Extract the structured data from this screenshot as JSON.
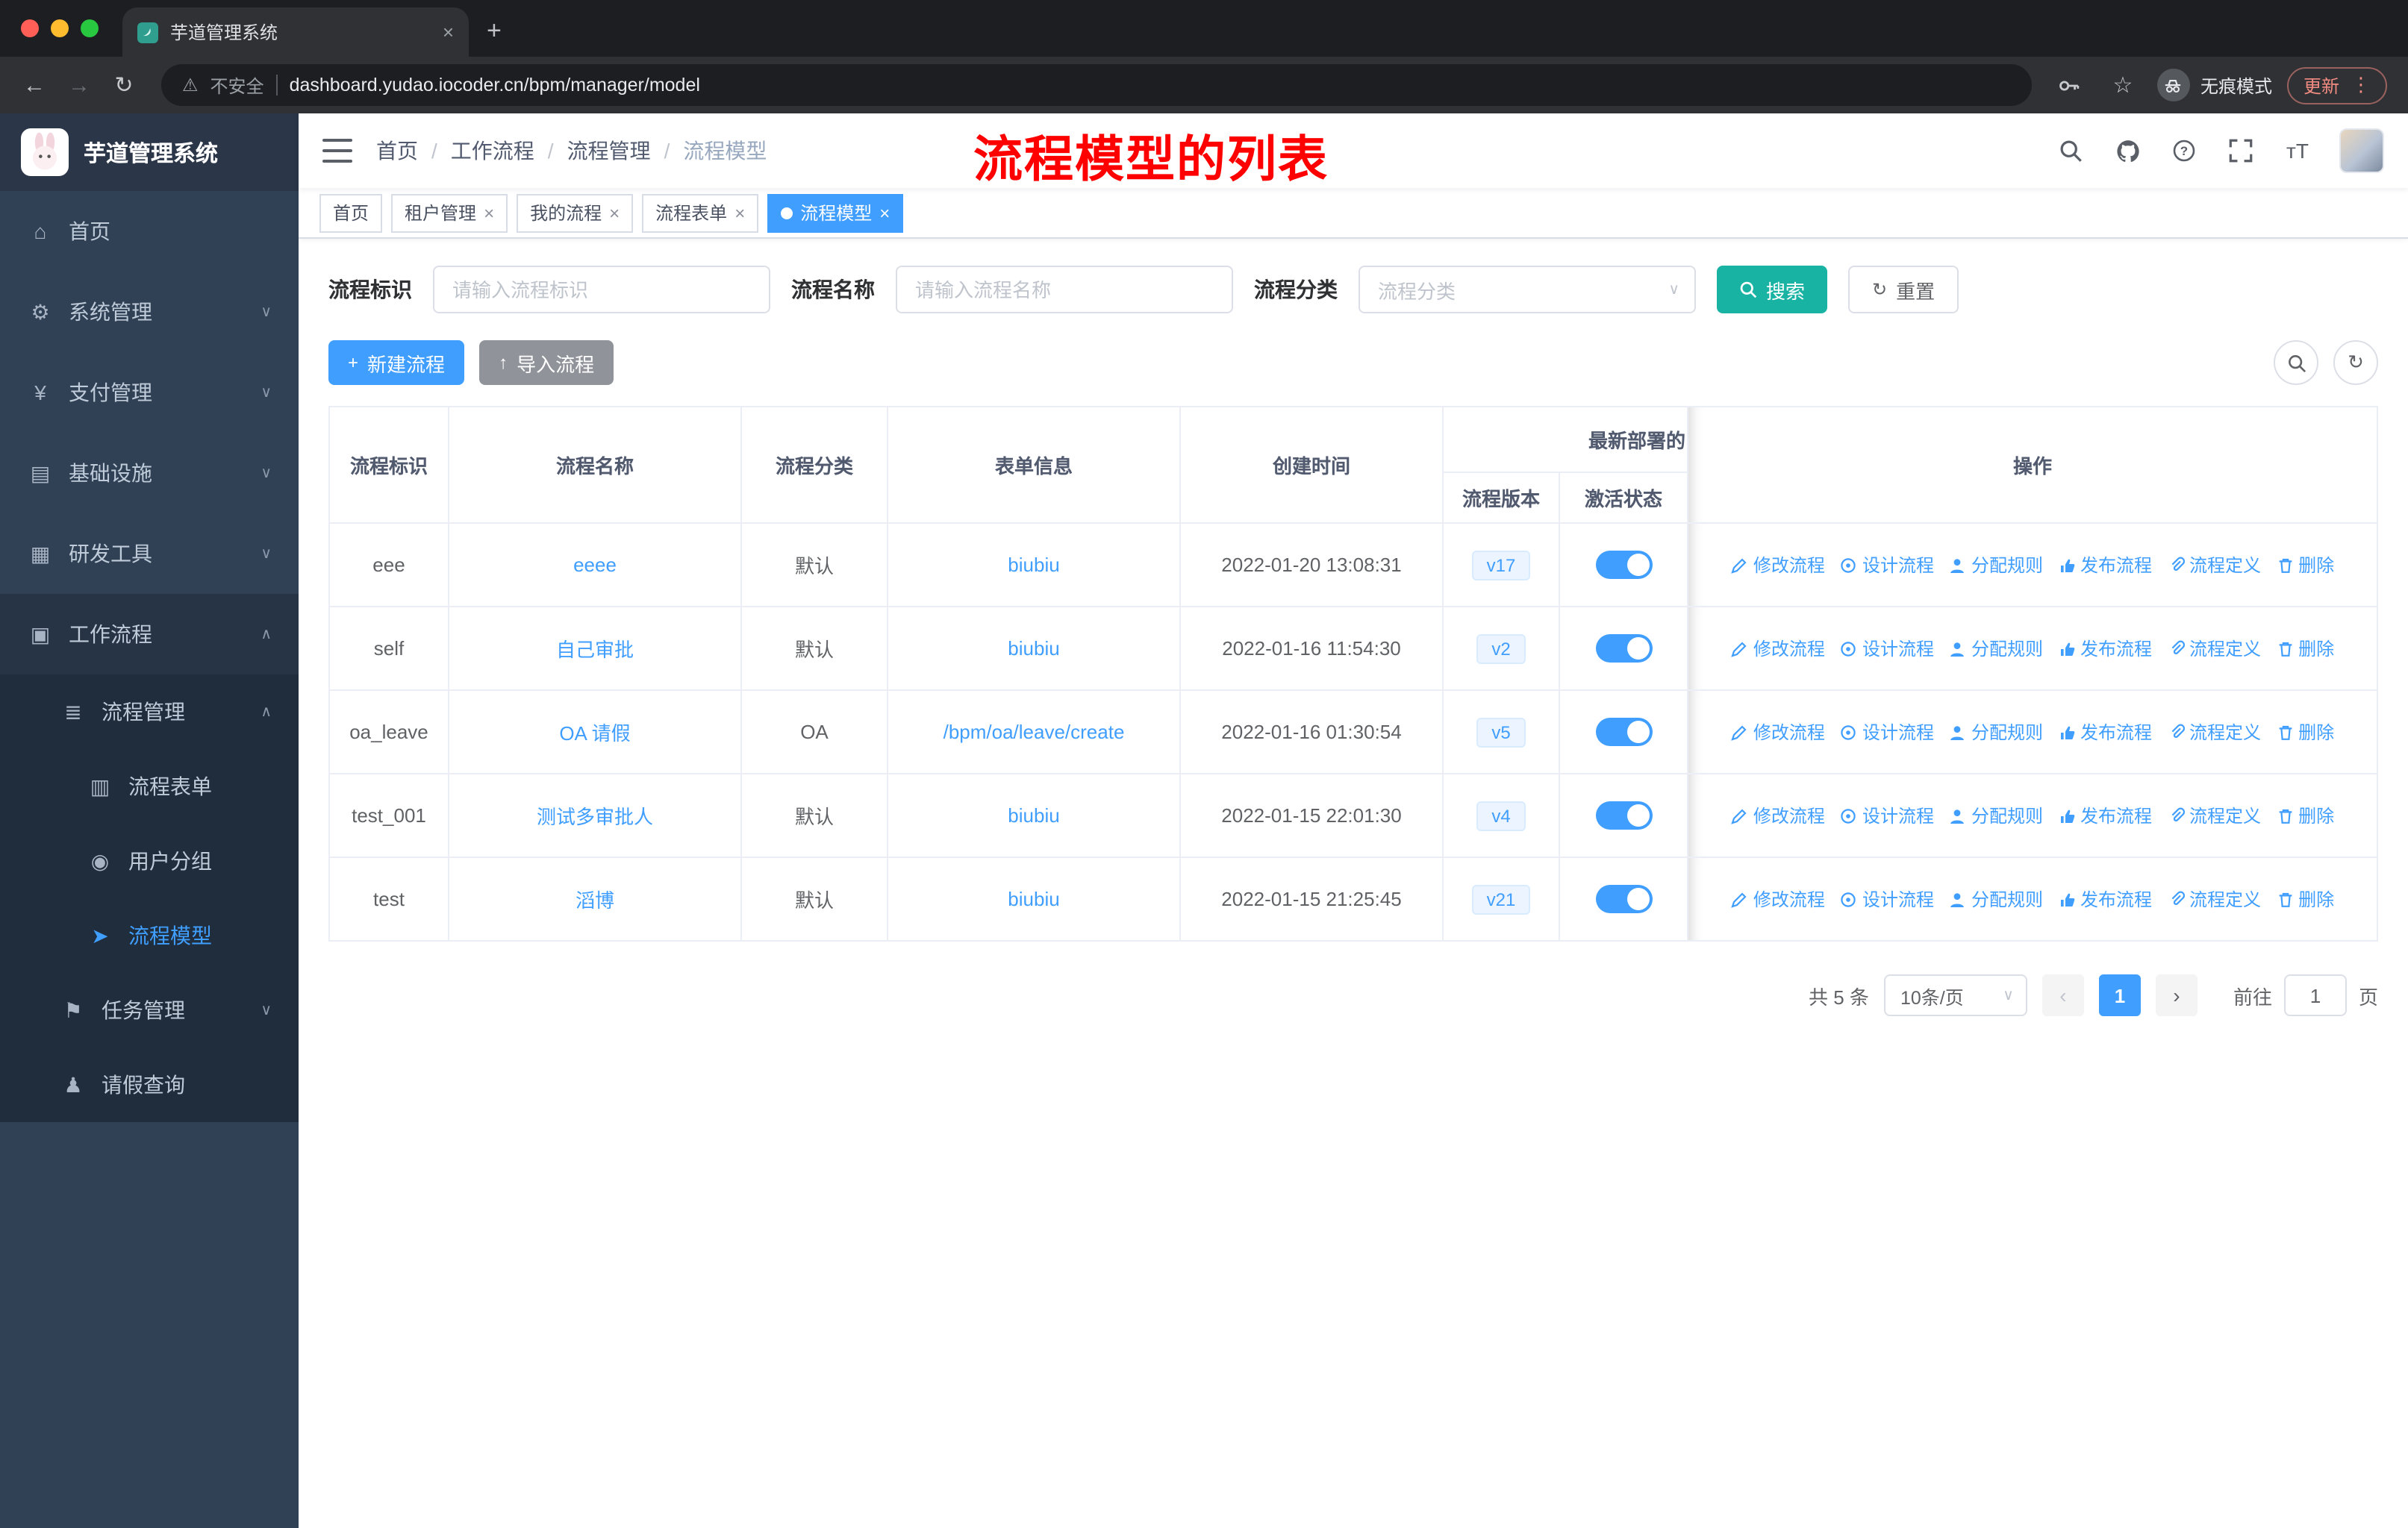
{
  "browser": {
    "tab_title": "芋道管理系统",
    "security_label": "不安全",
    "url": "dashboard.yudao.iocoder.cn/bpm/manager/model",
    "incognito_label": "无痕模式",
    "update_label": "更新"
  },
  "icons": {
    "dashboard": "⌂",
    "system": "⚙",
    "payment": "¥",
    "infrastructure": "▤",
    "devtools": "▦",
    "workflow": "▣",
    "process_management": "≣",
    "process_form": "▥",
    "user_group": "◉",
    "process_model": "➤",
    "task_management": "⚑",
    "leave_query": "♟",
    "chevron_down": "∨",
    "chevron_up": "∧",
    "close": "×",
    "plus": "+",
    "upload": "↑",
    "refresh": "↻",
    "reload": "↻",
    "star": "☆",
    "back": "←",
    "forward": "→",
    "warning": "⚠",
    "menu_dots": "⋮",
    "font_size": "тT",
    "new_tab": "+",
    "prev": "‹",
    "next": "›"
  },
  "sidebar": {
    "app_title": "芋道管理系统",
    "items": [
      {
        "label": "首页"
      },
      {
        "label": "系统管理"
      },
      {
        "label": "支付管理"
      },
      {
        "label": "基础设施"
      },
      {
        "label": "研发工具"
      },
      {
        "label": "工作流程"
      },
      {
        "label": "流程管理"
      },
      {
        "label": "流程表单"
      },
      {
        "label": "用户分组"
      },
      {
        "label": "流程模型"
      },
      {
        "label": "任务管理"
      },
      {
        "label": "请假查询"
      }
    ]
  },
  "navbar": {
    "breadcrumb": [
      "首页",
      "工作流程",
      "流程管理",
      "流程模型"
    ],
    "annotation": "流程模型的列表"
  },
  "tags": [
    "首页",
    "租户管理",
    "我的流程",
    "流程表单",
    "流程模型"
  ],
  "filter": {
    "key_label": "流程标识",
    "key_placeholder": "请输入流程标识",
    "name_label": "流程名称",
    "name_placeholder": "请输入流程名称",
    "category_label": "流程分类",
    "category_placeholder": "流程分类",
    "search": "搜索",
    "reset": "重置"
  },
  "toolbar": {
    "create": "新建流程",
    "import": "导入流程"
  },
  "table": {
    "headers": {
      "key": "流程标识",
      "name": "流程名称",
      "category": "流程分类",
      "form": "表单信息",
      "created": "创建时间",
      "deploy_group": "最新部署的",
      "version": "流程版本",
      "active": "激活状态",
      "actions": "操作"
    },
    "actions": [
      "修改流程",
      "设计流程",
      "分配规则",
      "发布流程",
      "流程定义",
      "删除"
    ],
    "rows": [
      {
        "key": "eee",
        "name": "eeee",
        "category": "默认",
        "form": "biubiu",
        "created": "2022-01-20 13:08:31",
        "version": "v17"
      },
      {
        "key": "self",
        "name": "自己审批",
        "category": "默认",
        "form": "biubiu",
        "created": "2022-01-16 11:54:30",
        "version": "v2"
      },
      {
        "key": "oa_leave",
        "name": "OA 请假",
        "category": "OA",
        "form": "/bpm/oa/leave/create",
        "created": "2022-01-16 01:30:54",
        "version": "v5"
      },
      {
        "key": "test_001",
        "name": "测试多审批人",
        "category": "默认",
        "form": "biubiu",
        "created": "2022-01-15 22:01:30",
        "version": "v4"
      },
      {
        "key": "test",
        "name": "滔博",
        "category": "默认",
        "form": "biubiu",
        "created": "2022-01-15 21:25:45",
        "version": "v21"
      }
    ]
  },
  "pagination": {
    "total": "共 5 条",
    "page_size": "10条/页",
    "page": "1",
    "goto": "前往",
    "unit": "页"
  },
  "colors": {
    "primary_blue": "#409eff",
    "search_teal": "#18b3a3",
    "import_gray": "#909399",
    "annotation_red": "#fe0000",
    "sidebar_bg": "#304156",
    "sidebar_sub_bg": "#1f2d3d"
  }
}
